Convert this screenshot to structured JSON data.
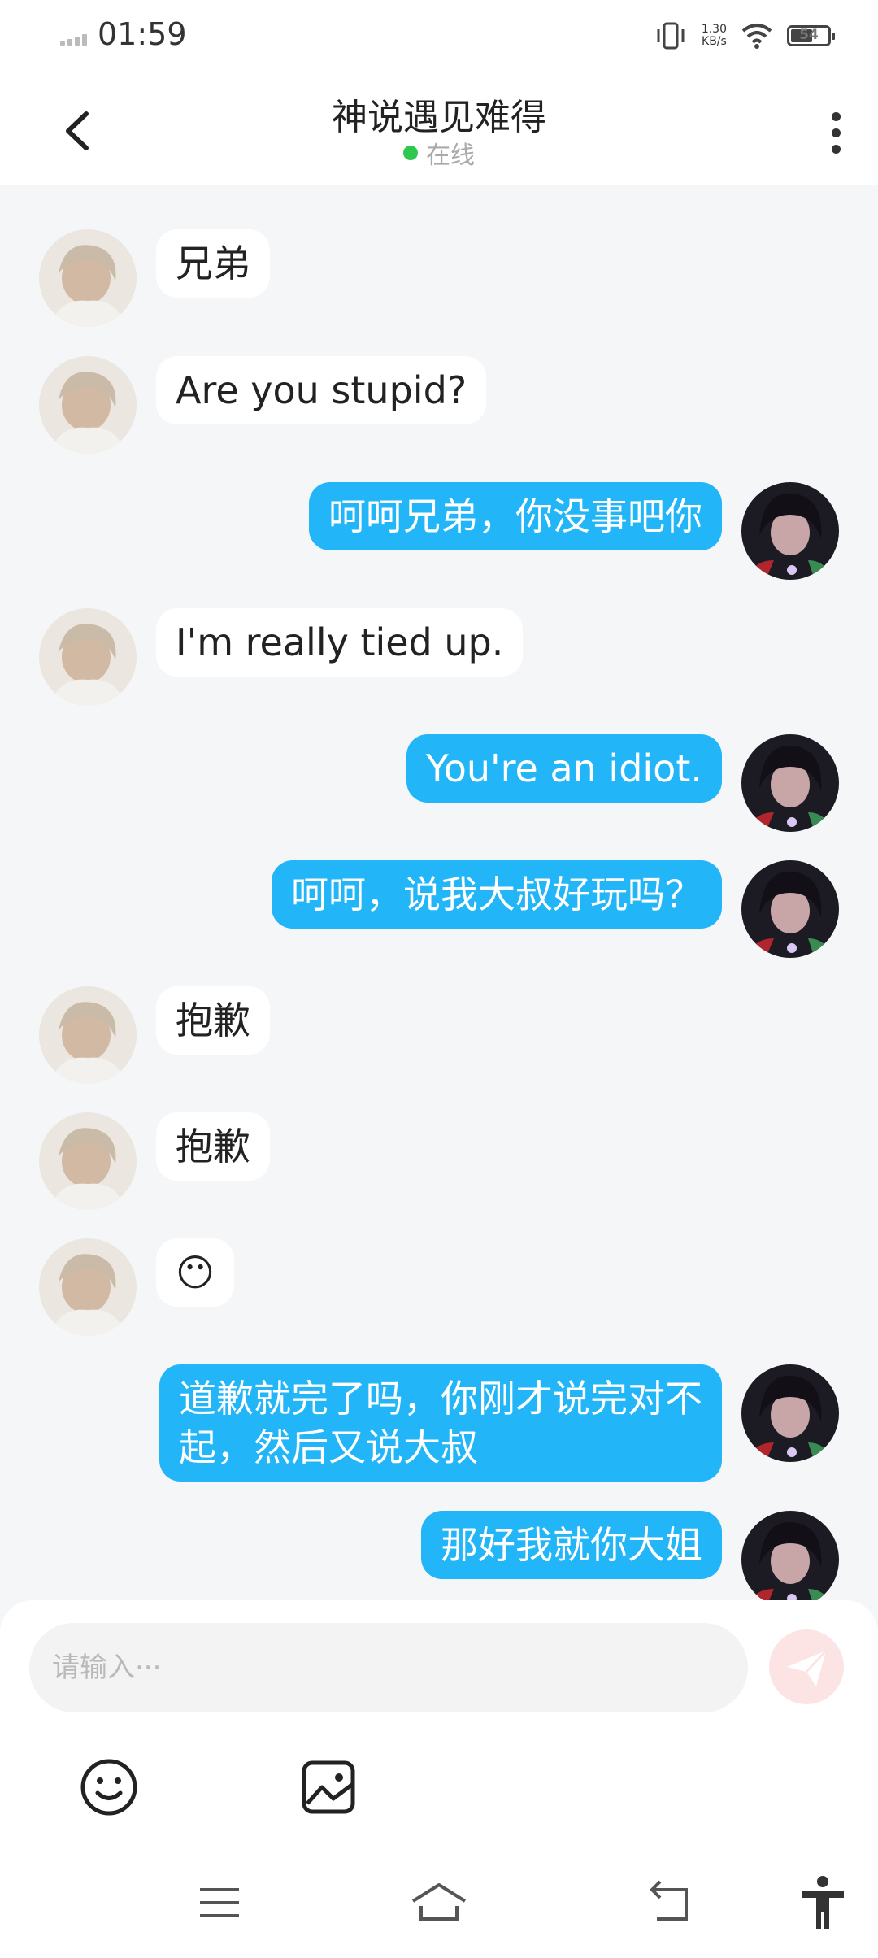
{
  "status_bar": {
    "time": "01:59",
    "net_speed": "1.30",
    "net_unit": "KB/s",
    "battery": "54"
  },
  "header": {
    "title": "神说遇见难得",
    "status": "在线",
    "status_color": "#2dc84d"
  },
  "messages": [
    {
      "side": "left",
      "text": "兄弟"
    },
    {
      "side": "left",
      "text": "Are you stupid?"
    },
    {
      "side": "right",
      "text": "呵呵兄弟，你没事吧你"
    },
    {
      "side": "left",
      "text": "I'm really tied up."
    },
    {
      "side": "right",
      "text": "You're an idiot."
    },
    {
      "side": "right",
      "text": "呵呵，说我大叔好玩吗？"
    },
    {
      "side": "left",
      "text": "抱歉"
    },
    {
      "side": "left",
      "text": "抱歉"
    },
    {
      "side": "left",
      "text": "😶"
    },
    {
      "side": "right",
      "text": "道歉就完了吗，你刚才说完对不\n起，然后又说大叔"
    },
    {
      "side": "right",
      "text": "那好我就你大姐"
    }
  ],
  "input": {
    "placeholder": "请输入···",
    "value": ""
  },
  "toolbar": {
    "emoji_icon": "smiley-icon",
    "image_icon": "image-icon",
    "send_icon": "paper-plane-icon"
  },
  "colors": {
    "outgoing_bubble": "#22b5f8",
    "incoming_bubble": "#ffffff",
    "background": "#f5f6f8"
  }
}
